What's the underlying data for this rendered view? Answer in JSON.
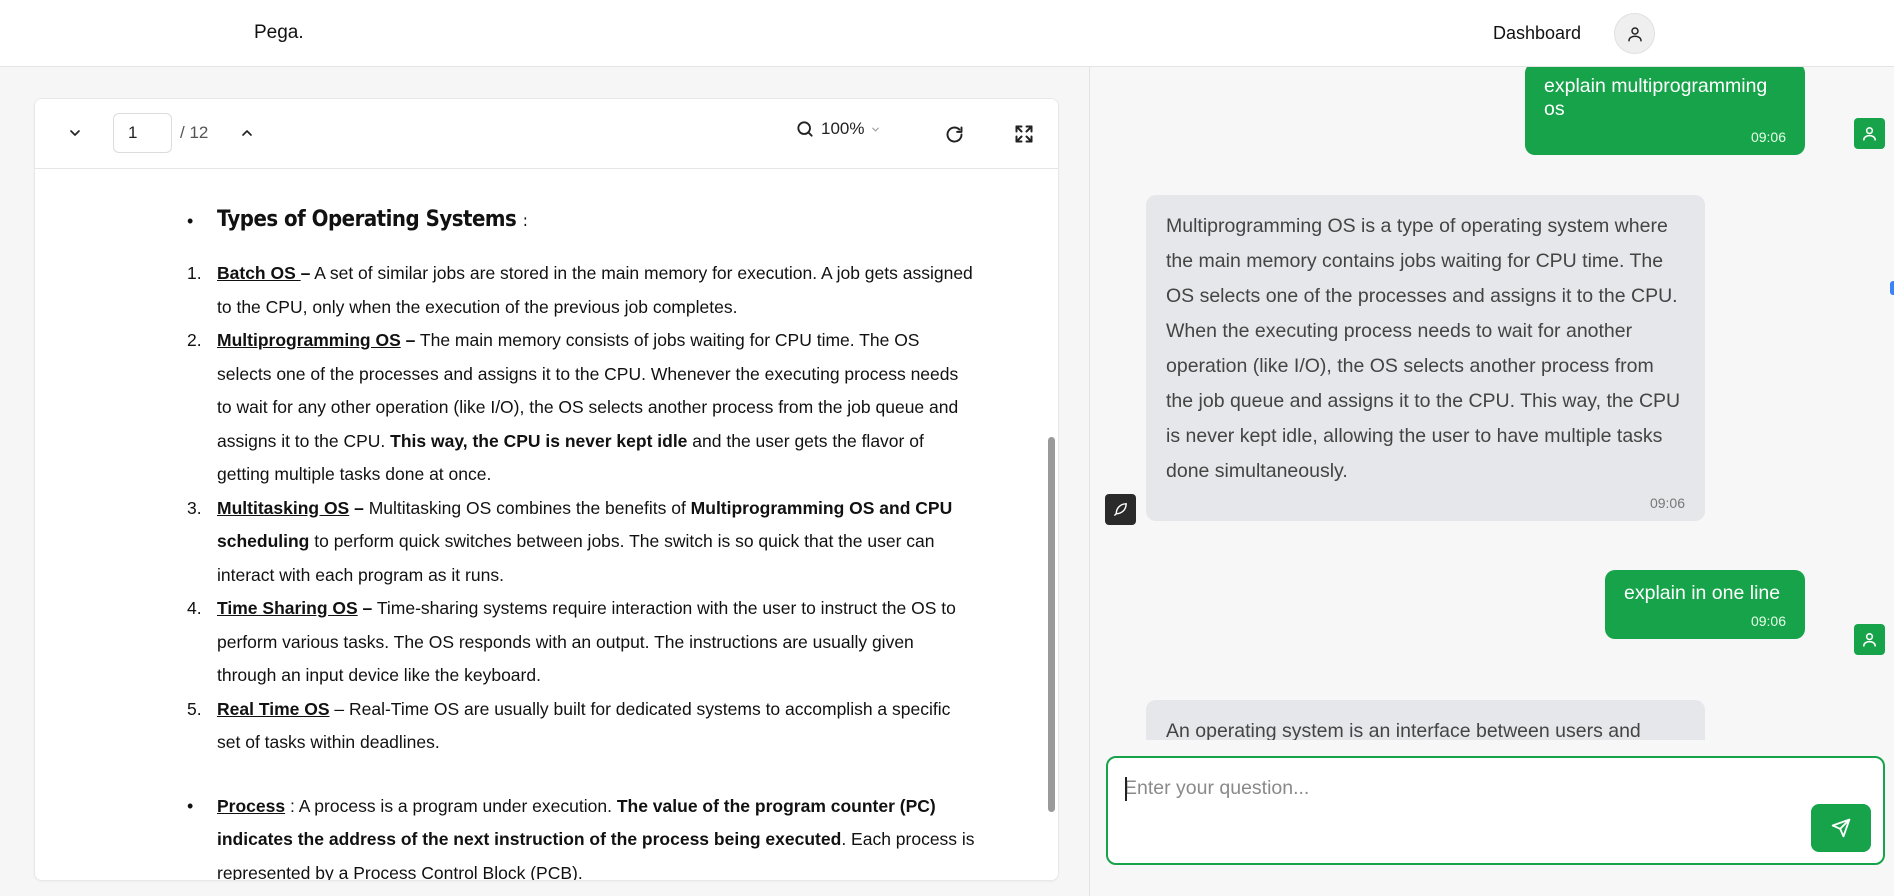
{
  "header": {
    "logo": "Pega.",
    "nav_dashboard": "Dashboard",
    "profile_icon": "user-icon"
  },
  "viewer": {
    "toolbar": {
      "page_current": "1",
      "page_total": "/ 12",
      "zoom": "100%"
    },
    "doc": {
      "heading": "Types of Operating Systems",
      "heading_suffix": ":",
      "items": [
        {
          "num": "1.",
          "term": "Batch OS ",
          "dash": "–",
          "text": " A set of similar jobs are stored in the main memory for execution. A job gets assigned to the CPU, only when the execution of the previous job completes."
        },
        {
          "num": "2.",
          "term": "Multiprogramming OS",
          "dash": " –",
          "text": " The main memory consists of jobs waiting for CPU time. The OS selects one of the processes and assigns it to the CPU. Whenever the executing process needs to wait for any other operation (like I/O), the OS selects another process from the job queue and assigns it to the CPU. ",
          "bold": "This way, the CPU is never kept idle",
          "text2": " and the user gets the flavor of getting multiple tasks done at once."
        },
        {
          "num": "3.",
          "term": "Multitasking OS",
          "dash": " –",
          "text": " Multitasking OS combines the benefits of ",
          "bold": "Multiprogramming OS and CPU scheduling",
          "text2": " to perform quick switches between jobs. The switch is so quick that the user can interact with each program as it runs."
        },
        {
          "num": "4.",
          "term": "Time Sharing OS",
          "dash": " –",
          "text": " Time-sharing systems require interaction with the user to instruct the OS to perform various tasks. The OS responds with an output. The instructions are usually given through an input device like the keyboard."
        },
        {
          "num": "5.",
          "term": "Real Time OS",
          "dash": "",
          "text": " – Real-Time OS are usually built for dedicated systems to accomplish a specific set of tasks within deadlines."
        }
      ],
      "process": {
        "term": "Process",
        "text": " : A process is a program under execution. ",
        "bold": "The value of the program counter (PC) indicates the address of the next instruction of the process being executed",
        "text2": ". Each process is represented by a Process Control Block (PCB)."
      }
    }
  },
  "chat": {
    "messages": [
      {
        "role": "user",
        "text": "explain multiprogramming os",
        "time": "09:06"
      },
      {
        "role": "bot",
        "text": "Multiprogramming OS is a type of operating system where the main memory contains jobs waiting for CPU time. The OS selects one of the processes and assigns it to the CPU. When the executing process needs to wait for another operation (like I/O), the OS selects another process from the job queue and assigns it to the CPU. This way, the CPU is never kept idle, allowing the user to have multiple tasks done simultaneously.",
        "time": "09:06"
      },
      {
        "role": "user",
        "text": "explain in one line",
        "time": "09:06"
      },
      {
        "role": "bot",
        "text": "An operating system is an interface between users and",
        "time": ""
      }
    ],
    "input_placeholder": "Enter your question..."
  },
  "colors": {
    "accent": "#16a34a",
    "bot_bubble": "#e6e7ea"
  }
}
